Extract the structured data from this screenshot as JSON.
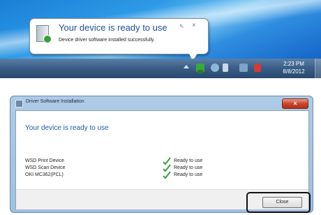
{
  "notification": {
    "title": "Your device is ready to use",
    "message": "Device driver software installed successfully.",
    "pin_glyph": "⇖",
    "close_glyph": "×"
  },
  "taskbar": {
    "clock_time": "2:23 PM",
    "clock_date": "8/8/2012"
  },
  "dialog": {
    "title": "Driver Software Installation",
    "close_glyph": "×",
    "heading": "Your device is ready to use",
    "devices": [
      {
        "name": "WSD Print Device",
        "status": "Ready to use"
      },
      {
        "name": "WSD Scan Device",
        "status": "Ready to use"
      },
      {
        "name": "OKI MC362(PCL)",
        "status": "Ready to use"
      }
    ],
    "close_button_label": "Close"
  },
  "colors": {
    "heading_blue": "#1f5aa8",
    "check_green": "#3aa23d",
    "title_bar_close_red": "#c9462f"
  },
  "icons": [
    "device-install-icon",
    "pin-icon",
    "close-icon",
    "usb-device-icon",
    "checkmark-icon"
  ]
}
